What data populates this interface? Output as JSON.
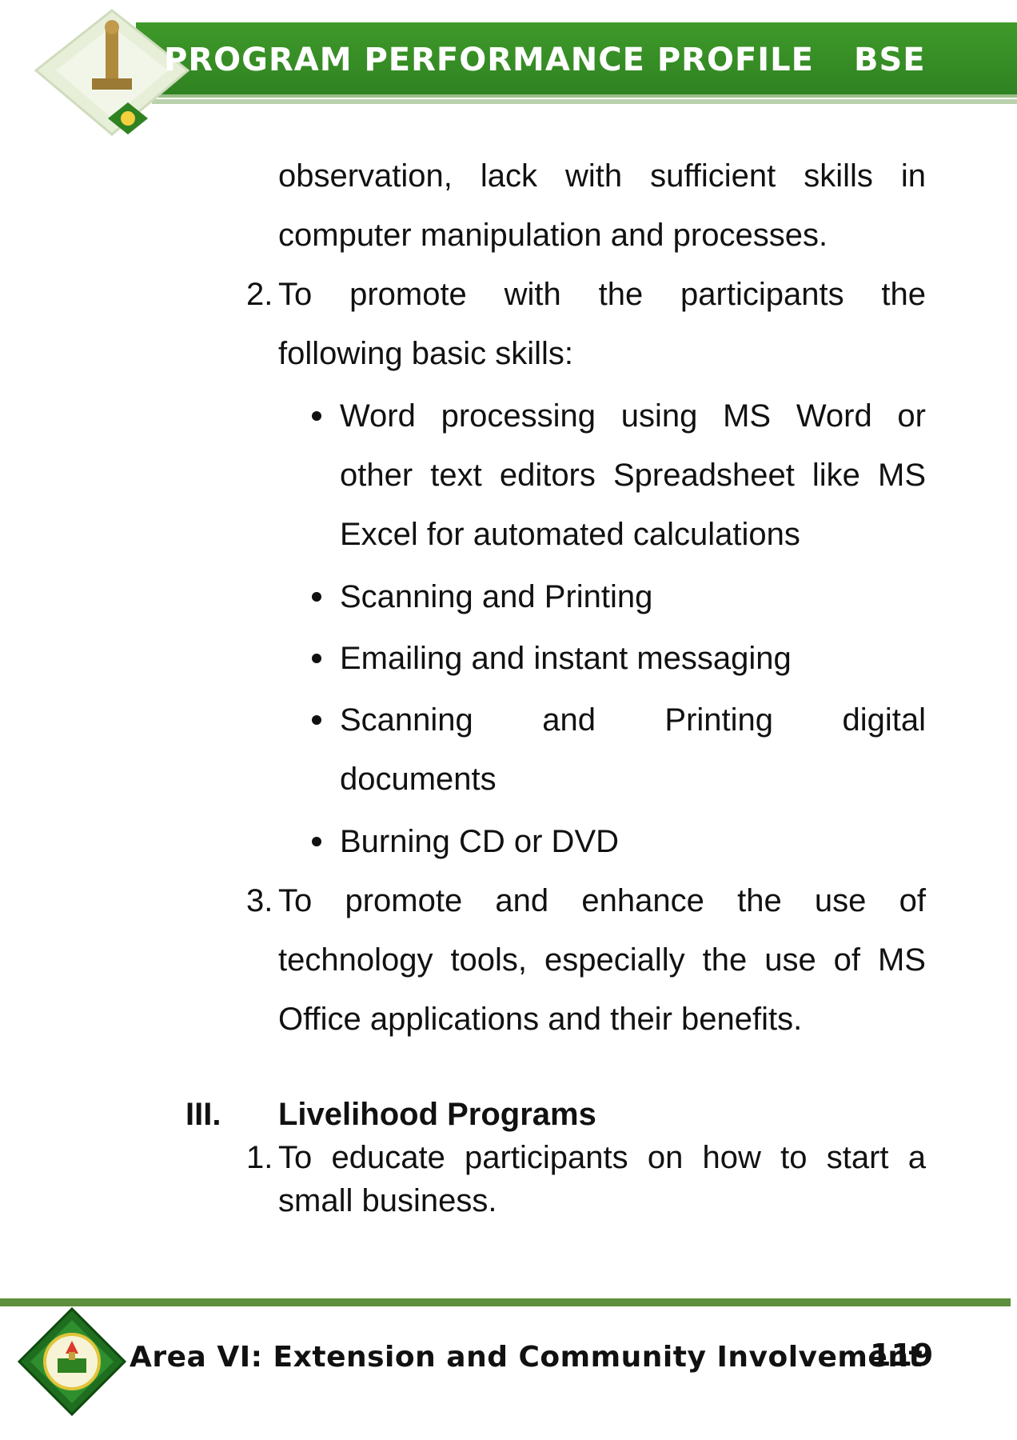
{
  "header": {
    "title": "PROGRAM PERFORMANCE PROFILE",
    "program_code": "BSE"
  },
  "content": {
    "item1_continuation": {
      "line1": "observation, lack with sufficient skills in",
      "line2": "computer manipulation and processes."
    },
    "item2": {
      "number": "2.",
      "line1": "To promote with the participants the",
      "line2": "following basic skills:"
    },
    "skills": [
      {
        "lines": [
          "Word processing using MS Word or",
          "other text editors Spreadsheet like MS",
          "Excel for automated calculations"
        ]
      },
      {
        "lines": [
          "Scanning and Printing"
        ]
      },
      {
        "lines": [
          "Emailing and instant messaging"
        ]
      },
      {
        "lines": [
          "Scanning and Printing digital",
          "documents"
        ]
      },
      {
        "lines": [
          "Burning CD or DVD"
        ]
      }
    ],
    "item3": {
      "number": "3.",
      "line1": "To promote and enhance the use of",
      "line2": "technology tools, especially the use of MS",
      "line3": "Office applications and their benefits."
    },
    "section3": {
      "numeral": "III.",
      "heading": "Livelihood Programs",
      "item1": {
        "number": "1.",
        "line1": "To educate participants on how to start a",
        "line2": "small business."
      }
    }
  },
  "footer": {
    "area_title": "Area VI: Extension and Community Involvement",
    "page_number": "119"
  },
  "colors": {
    "header_green": "#2f8221",
    "footer_rule": "#5d8f3c"
  }
}
